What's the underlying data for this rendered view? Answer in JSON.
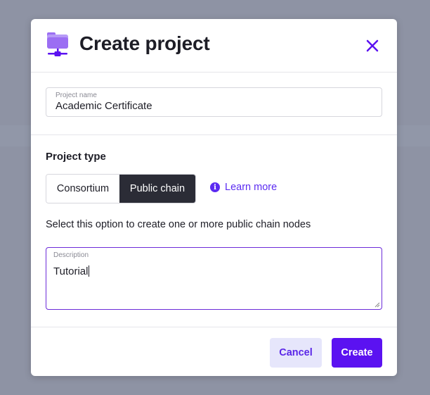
{
  "dialog": {
    "title": "Create project",
    "icon": "project-folder-network-icon",
    "close_icon": "close-icon"
  },
  "project_name": {
    "label": "Project name",
    "value": "Academic Certificate"
  },
  "project_type": {
    "heading": "Project type",
    "options": [
      {
        "label": "Consortium",
        "selected": false
      },
      {
        "label": "Public chain",
        "selected": true
      }
    ],
    "learn_more": "Learn more",
    "info_icon": "info-icon",
    "helper_text": "Select this option to create one or more public chain nodes"
  },
  "description": {
    "label": "Description",
    "value": "Tutorial"
  },
  "footer": {
    "cancel_label": "Cancel",
    "create_label": "Create"
  },
  "colors": {
    "accent": "#5b12f1",
    "selected_segment": "#2b2c36",
    "cancel_bg": "#e6e6fb",
    "focus_border": "#6c2bd9"
  }
}
